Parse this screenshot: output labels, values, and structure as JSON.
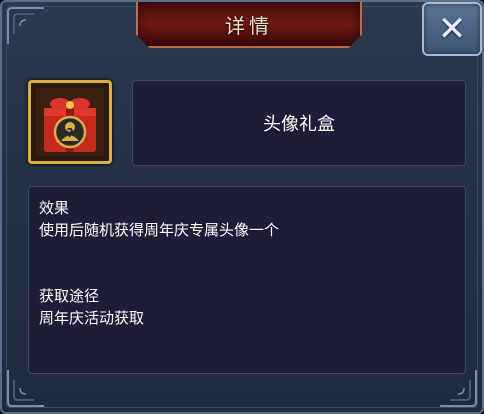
{
  "dialog": {
    "title": "详情",
    "close_symbol": "✕",
    "close_icon": "close-icon"
  },
  "item": {
    "icon": "avatar-gift-box-icon",
    "name": "头像礼盒"
  },
  "description": {
    "effect_heading": "效果",
    "effect_text": "使用后随机获得周年庆专属头像一个",
    "source_heading": "获取途径",
    "source_text": "周年庆活动获取"
  },
  "colors": {
    "frame": "#2b3850",
    "panel": "#1d1d38",
    "title_plaque": "#6e1712",
    "item_border": "#d8b046",
    "gift_red": "#c42a1f"
  }
}
